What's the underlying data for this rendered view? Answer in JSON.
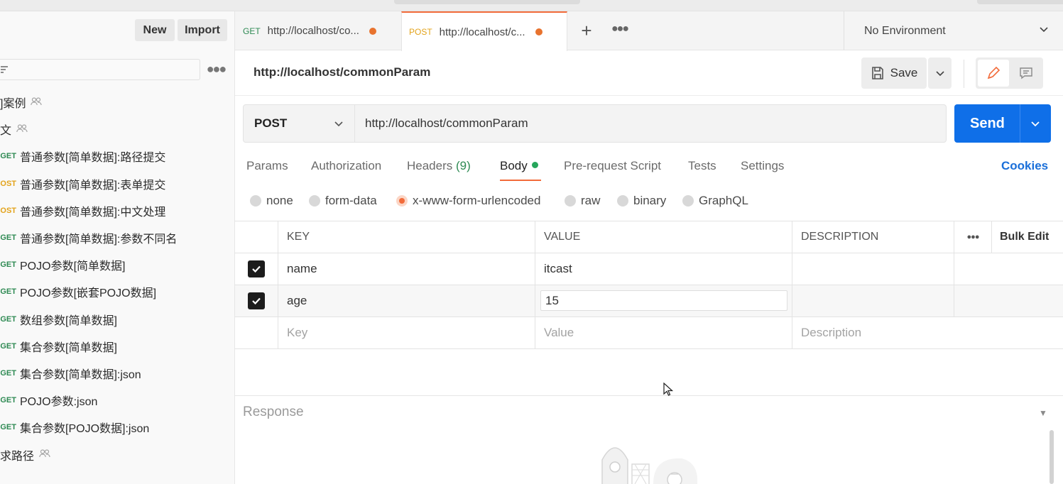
{
  "sidebar": {
    "new_label": "New",
    "import_label": "Import",
    "filter_icon": "filter-icon",
    "items": [
      {
        "type": "folder",
        "label": "]案例"
      },
      {
        "type": "folder",
        "label": "文"
      },
      {
        "type": "request",
        "method": "GET",
        "label": "普通参数[简单数据]:路径提交"
      },
      {
        "type": "request",
        "method": "POST",
        "label": "普通参数[简单数据]:表单提交"
      },
      {
        "type": "request",
        "method": "POST",
        "label": "普通参数[简单数据]:中文处理"
      },
      {
        "type": "request",
        "method": "GET",
        "label": "普通参数[简单数据]:参数不同名"
      },
      {
        "type": "request",
        "method": "GET",
        "label": "POJO参数[简单数据]"
      },
      {
        "type": "request",
        "method": "GET",
        "label": "POJO参数[嵌套POJO数据]"
      },
      {
        "type": "request",
        "method": "GET",
        "label": "数组参数[简单数据]"
      },
      {
        "type": "request",
        "method": "GET",
        "label": "集合参数[简单数据]"
      },
      {
        "type": "request",
        "method": "GET",
        "label": "集合参数[简单数据]:json"
      },
      {
        "type": "request",
        "method": "GET",
        "label": "POJO参数:json"
      },
      {
        "type": "request",
        "method": "GET",
        "label": "集合参数[POJO数据]:json"
      },
      {
        "type": "folder",
        "label": "求路径"
      }
    ]
  },
  "tabs": [
    {
      "method": "GET",
      "label": "http://localhost/co...",
      "active": false
    },
    {
      "method": "POST",
      "label": "http://localhost/c...",
      "active": true
    }
  ],
  "environment": {
    "label": "No Environment"
  },
  "request": {
    "title": "http://localhost/commonParam",
    "save_label": "Save",
    "method": "POST",
    "url": "http://localhost/commonParam",
    "send_label": "Send"
  },
  "request_tabs": {
    "params": "Params",
    "authorization": "Authorization",
    "headers": "Headers",
    "headers_count": "(9)",
    "body": "Body",
    "prerequest": "Pre-request Script",
    "tests": "Tests",
    "settings": "Settings",
    "cookies": "Cookies"
  },
  "body_types": {
    "none": "none",
    "form_data": "form-data",
    "urlencoded": "x-www-form-urlencoded",
    "raw": "raw",
    "binary": "binary",
    "graphql": "GraphQL",
    "selected": "x-www-form-urlencoded"
  },
  "params_table": {
    "headers": {
      "key": "KEY",
      "value": "VALUE",
      "description": "DESCRIPTION",
      "bulk_edit": "Bulk Edit"
    },
    "rows": [
      {
        "checked": true,
        "key": "name",
        "value": "itcast",
        "description": ""
      },
      {
        "checked": true,
        "key": "age",
        "value": "15",
        "description": ""
      }
    ],
    "placeholders": {
      "key": "Key",
      "value": "Value",
      "description": "Description"
    }
  },
  "response": {
    "title": "Response"
  },
  "colors": {
    "accent": "#f26b3a",
    "send": "#0f6fe8",
    "get": "#2e8a53",
    "post": "#e3a31b",
    "link": "#1a6fd9"
  }
}
